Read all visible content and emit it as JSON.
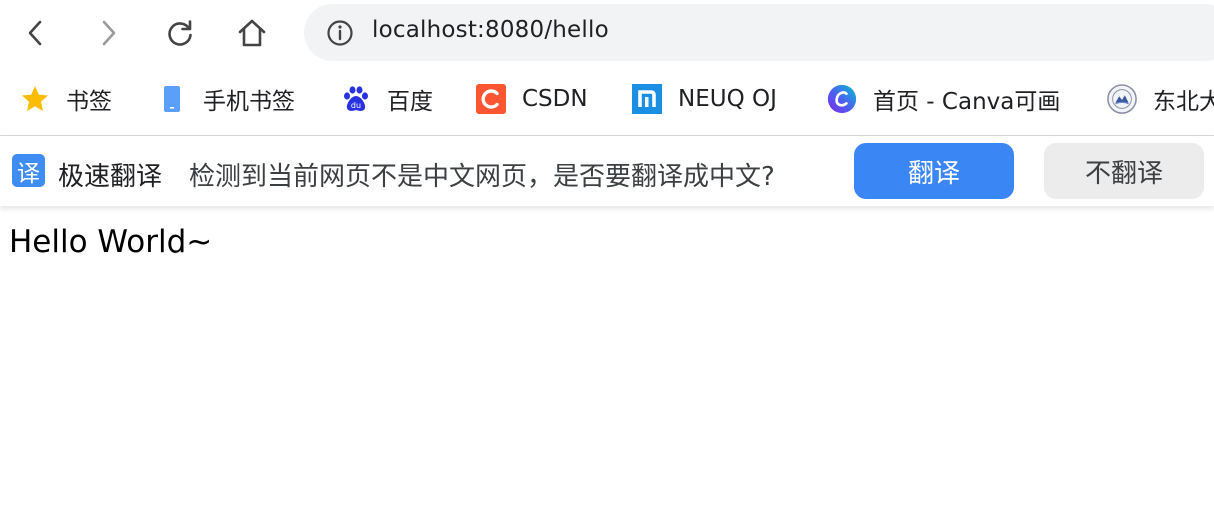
{
  "toolbar": {
    "back_icon": "chevron-left-icon",
    "forward_icon": "chevron-right-icon",
    "reload_icon": "reload-icon",
    "home_icon": "home-icon",
    "address": {
      "info_icon": "info-icon",
      "url": "localhost:8080/hello"
    }
  },
  "bookmarks": {
    "items": [
      {
        "label": "书签",
        "icon": "star-icon"
      },
      {
        "label": "手机书签",
        "icon": "phone-icon"
      },
      {
        "label": "百度",
        "icon": "baidu-icon"
      },
      {
        "label": "CSDN",
        "icon": "csdn-icon"
      },
      {
        "label": "NEUQ OJ",
        "icon": "neuq-icon"
      },
      {
        "label": "首页 - Canva可画",
        "icon": "canva-icon"
      },
      {
        "label": "东北大",
        "icon": "university-seal-icon"
      }
    ]
  },
  "translate_bar": {
    "icon_text": "译",
    "title": "极速翻译",
    "message": "检测到当前网页不是中文网页，是否要翻译成中文?",
    "translate_button": "翻译",
    "no_translate_button": "不翻译",
    "colors": {
      "primary": "#3b86f5",
      "secondary": "#ececec"
    }
  },
  "page": {
    "content": "Hello World~"
  }
}
